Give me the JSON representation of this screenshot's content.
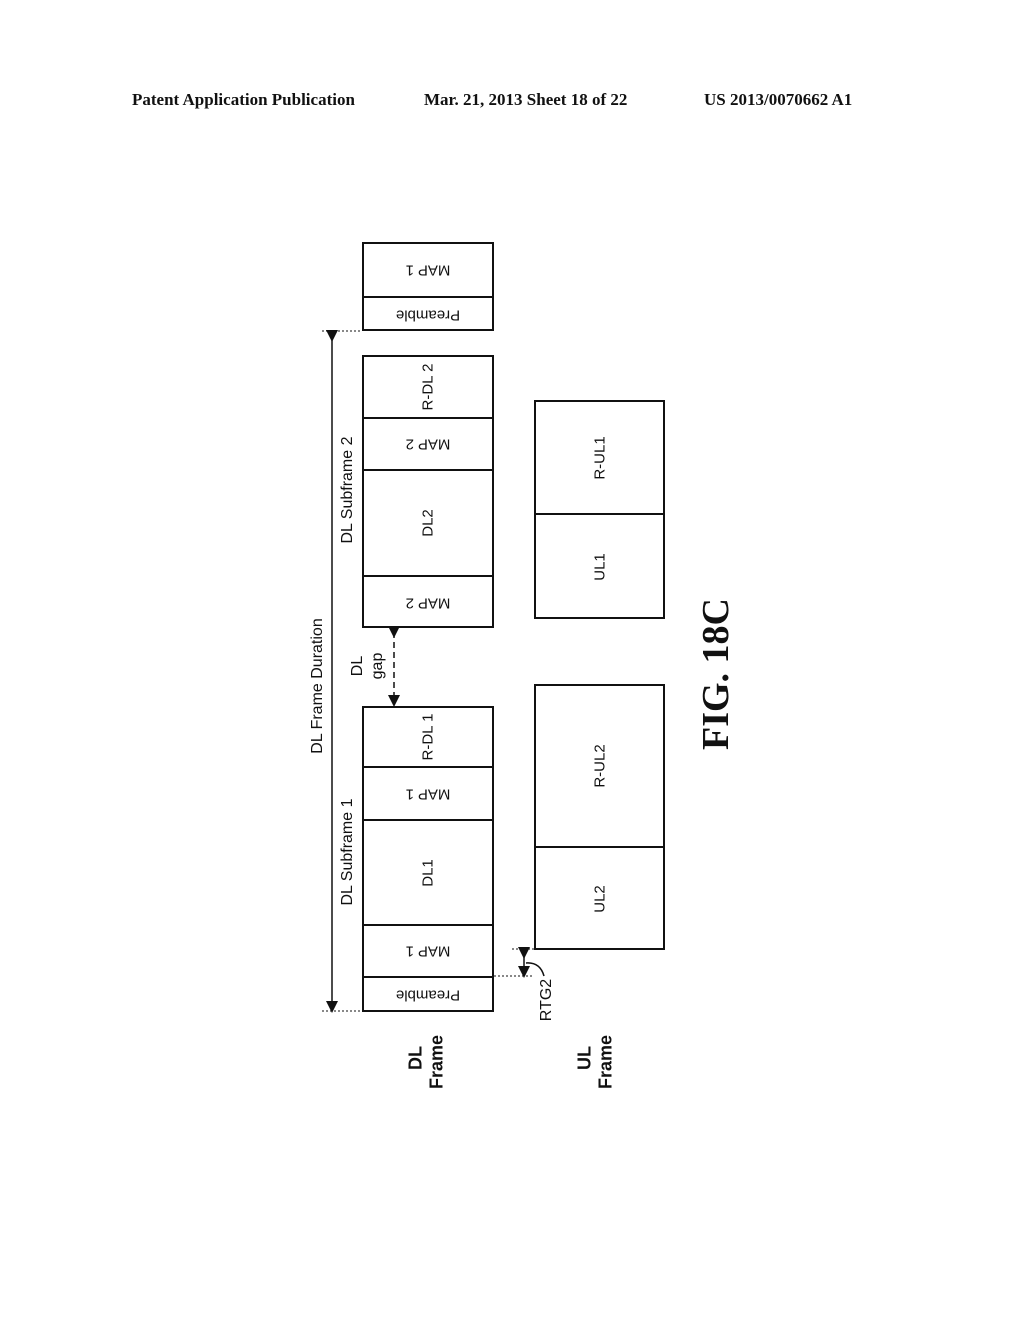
{
  "header": {
    "left": "Patent Application Publication",
    "center": "Mar. 21, 2013  Sheet 18 of 22",
    "right": "US 2013/0070662 A1"
  },
  "figure": {
    "caption": "FIG. 18C",
    "frame_duration_label": "DL Frame Duration",
    "dl_gap_label_line1": "DL",
    "dl_gap_label_line2": "gap",
    "rtg_label": "RTG2",
    "row_labels": {
      "dl_line1": "DL",
      "dl_line2": "Frame",
      "ul_line1": "UL",
      "ul_line2": "Frame"
    },
    "subframe_labels": {
      "sf1": "DL Subframe 1",
      "sf2": "DL Subframe 2"
    },
    "next_frame_blocks": [
      "Preamble",
      "MAP 1"
    ],
    "dl_subframe1_blocks": [
      "Preamble",
      "MAP 1",
      "DL1",
      "MAP 1",
      "R-DL 1"
    ],
    "dl_subframe2_blocks": [
      "MAP 2",
      "DL2",
      "MAP 2",
      "R-DL 2"
    ],
    "ul_frame1_blocks": [
      "UL2",
      "R-UL2"
    ],
    "ul_frame2_blocks": [
      "UL1",
      "R-UL1"
    ]
  }
}
